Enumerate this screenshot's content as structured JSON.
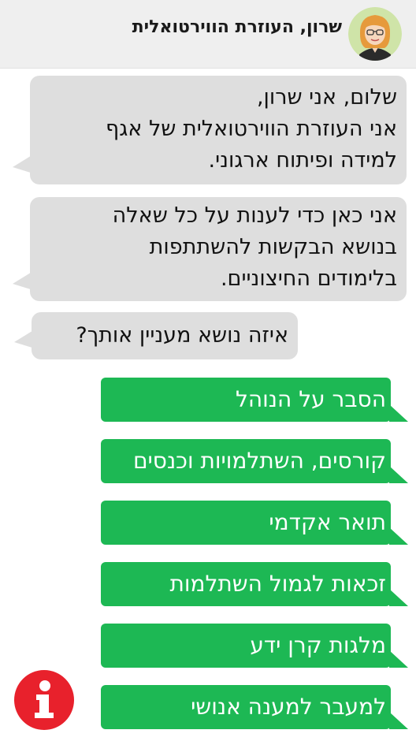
{
  "header": {
    "title": "שרון, העוזרת הווירטואלית",
    "avatar_icon": "female-assistant-avatar"
  },
  "messages": [
    {
      "lines": [
        "שלום, אני שרון,",
        "אני העוזרת הווירטואלית של אגף",
        "למידה ופיתוח ארגוני."
      ]
    },
    {
      "lines": [
        "אני כאן כדי לענות על כל שאלה",
        "בנושא הבקשות להשתתפות",
        "בלימודים החיצוניים."
      ]
    },
    {
      "lines": [
        "איזה נושא מעניין אותך?"
      ]
    }
  ],
  "options": [
    {
      "label": "הסבר על הנוהל"
    },
    {
      "label": "קורסים, השתלמויות וכנסים"
    },
    {
      "label": "תואר אקדמי"
    },
    {
      "label": "זכאות לגמול השתלמות"
    },
    {
      "label": "מלגות קרן ידע"
    },
    {
      "label": "למעבר למענה אנושי"
    }
  ],
  "colors": {
    "option_green": "#1db854",
    "bubble_gray": "#dedede",
    "info_red": "#e8212c"
  },
  "info_button_icon": "info-icon"
}
